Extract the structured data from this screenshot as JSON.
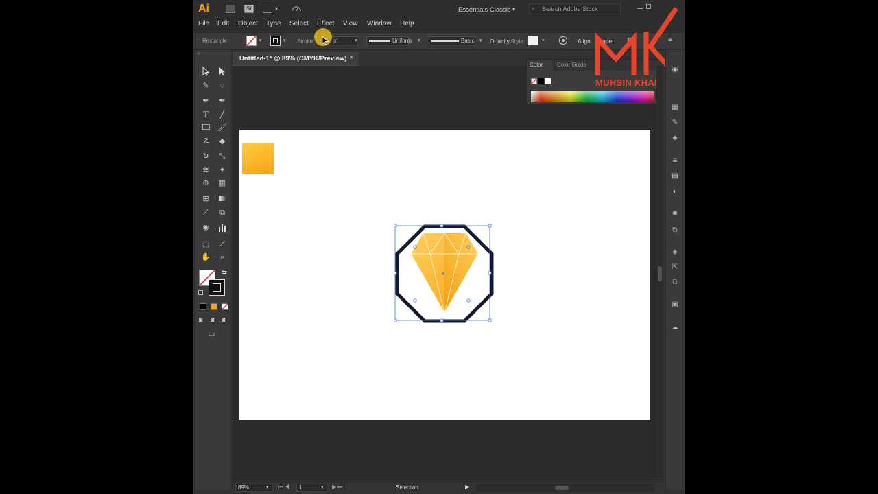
{
  "app": {
    "logo": "Ai",
    "workspace": "Essentials Classic",
    "search_placeholder": "Search Adobe Stock"
  },
  "menu": [
    "File",
    "Edit",
    "Object",
    "Type",
    "Select",
    "Effect",
    "View",
    "Window",
    "Help"
  ],
  "control": {
    "selection_type": "Rectangle",
    "stroke_label": "Stroke:",
    "stroke_value": "pt",
    "profile_uniform": "Uniform",
    "brush_basic": "Basic",
    "opacity_label": "Opacity",
    "style_label": "Style:",
    "align_label": "Align",
    "shape_label": "ape:"
  },
  "document": {
    "tab_title": "Untitled-1* @ 89% (CMYK/Preview)",
    "close_symbol": "×"
  },
  "color_panel": {
    "tabs": [
      "Color",
      "Color Guide"
    ]
  },
  "status": {
    "zoom": "89%",
    "page": "1",
    "tool_name": "Selection"
  },
  "watermark": {
    "monogram": "MK",
    "text": "MUHSIN KHAN"
  },
  "colors": {
    "brand_orange": "#ff9a00",
    "artboard": "#ffffff",
    "gem_yellow": "#ffc233",
    "gem_orange": "#f5a30e",
    "frame_stroke": "#141a2e",
    "selection_blue": "#3d7bd9",
    "watermark_red": "#e8462a"
  },
  "tool_icons": [
    "selection-arrow-icon",
    "direct-selection-icon",
    "magic-wand-icon",
    "lasso-icon",
    "pen-icon",
    "curvature-icon",
    "type-icon",
    "line-icon",
    "rectangle-icon",
    "paintbrush-icon",
    "shaper-icon",
    "eraser-icon",
    "rotate-icon",
    "scale-icon",
    "warp-icon",
    "puppet-warp-icon",
    "shape-builder-icon",
    "perspective-grid-icon",
    "mesh-icon",
    "gradient-icon",
    "eyedropper-icon",
    "blend-icon",
    "symbol-sprayer-icon",
    "column-graph-icon",
    "artboard-icon",
    "slice-icon",
    "hand-icon",
    "zoom-icon"
  ]
}
